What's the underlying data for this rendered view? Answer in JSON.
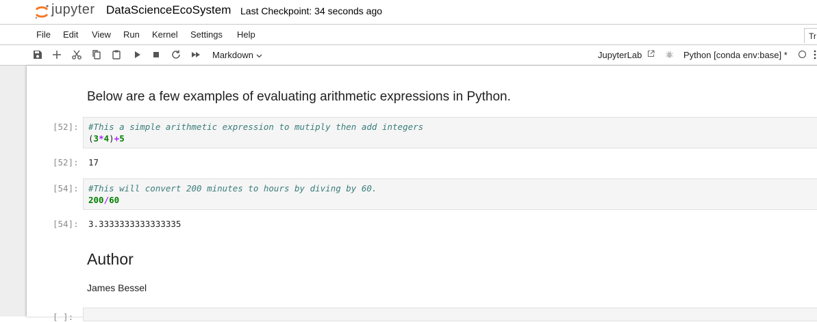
{
  "header": {
    "logo_text": "jupyter",
    "notebook_title": "DataScienceEcoSystem",
    "checkpoint": "Last Checkpoint: 34 seconds ago"
  },
  "menubar": {
    "items": [
      "File",
      "Edit",
      "View",
      "Run",
      "Kernel",
      "Settings",
      "Help"
    ],
    "tab_fragment": "Tr"
  },
  "toolbar": {
    "icons": [
      "save-icon",
      "add-cell-icon",
      "cut-icon",
      "copy-icon",
      "paste-icon",
      "run-icon",
      "stop-icon",
      "restart-icon",
      "fast-forward-icon"
    ],
    "cell_type": "Markdown",
    "jupyterlab_label": "JupyterLab",
    "kernel_name": "Python [conda env:base] *"
  },
  "cells": {
    "md_intro": "Below are a few examples of evaluating arithmetic expressions in Python.",
    "cell1": {
      "prompt": "[52]:",
      "comment": "#This a simple arithmetic expression to mutiply then add integers",
      "code_tokens": [
        "(",
        "3",
        "*",
        "4",
        ")",
        "+",
        "5"
      ],
      "output_prompt": "[52]:",
      "output": "17"
    },
    "cell2": {
      "prompt": "[54]:",
      "comment": "#This will convert 200 minutes to hours by diving by 60.",
      "code_tokens": [
        "200",
        "/",
        "60"
      ],
      "output_prompt": "[54]:",
      "output": "3.3333333333333335"
    },
    "author_heading": "Author",
    "author_name": "James Bessel",
    "empty_prompt": "[ ]:"
  },
  "colors": {
    "comment": "#3a7d7b",
    "number": "#008000",
    "operator": "#aa22ff",
    "prompt": "#8a8a8a",
    "logo_orange": "#f37726"
  }
}
